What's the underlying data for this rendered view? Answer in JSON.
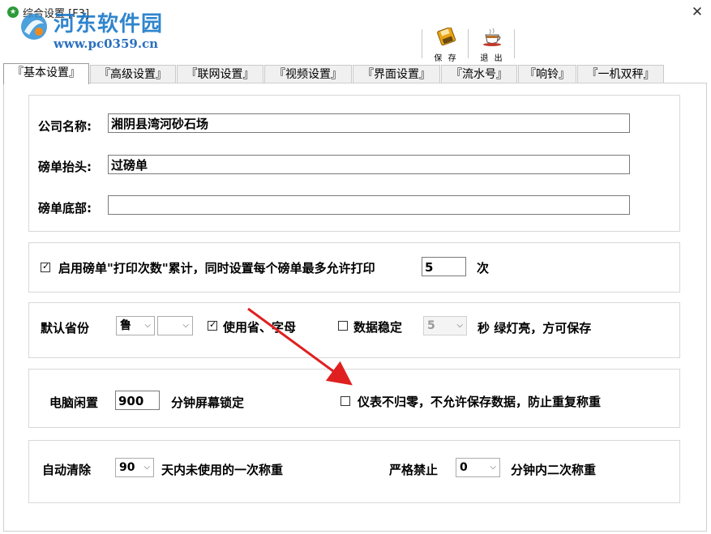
{
  "window": {
    "title": "综合设置 [F3]",
    "close_glyph": "✕"
  },
  "watermark": {
    "site_name": "河东软件园",
    "url": "www.pc0359.cn"
  },
  "toolbar": {
    "save_label": "保 存",
    "exit_label": "退 出"
  },
  "tabs": [
    {
      "label": "『基本设置』",
      "active": true
    },
    {
      "label": "『高级设置』",
      "active": false
    },
    {
      "label": "『联网设置』",
      "active": false
    },
    {
      "label": "『视频设置』",
      "active": false
    },
    {
      "label": "『界面设置』",
      "active": false
    },
    {
      "label": "『流水号』",
      "active": false
    },
    {
      "label": "『响铃』",
      "active": false
    },
    {
      "label": "『一机双秤』",
      "active": false
    }
  ],
  "company": {
    "company_name_label": "公司名称:",
    "company_name_value": "湘阴县湾河砂石场",
    "header_label": "磅单抬头:",
    "header_value": "过磅单",
    "footer_label": "磅单底部:",
    "footer_value": ""
  },
  "print_count": {
    "checked": true,
    "label": "启用磅单\"打印次数\"累计，同时设置每个磅单最多允许打印",
    "value": "5",
    "unit": "次"
  },
  "province": {
    "label": "默认省份",
    "province_value": "鲁",
    "letter_value": "",
    "use_letters_checked": true,
    "use_letters_label": "使用省、字母",
    "stable_checked": false,
    "stable_label": "数据稳定",
    "stable_seconds": "5",
    "stable_suffix": "秒  绿灯亮，方可保存"
  },
  "idle": {
    "label": "电脑闲置",
    "minutes": "900",
    "suffix": "分钟屏幕锁定",
    "no_zero_checked": false,
    "no_zero_label": "仪表不归零，不允许保存数据，防止重复称重"
  },
  "cleanup": {
    "label": "自动清除",
    "days": "90",
    "days_suffix": "天内未使用的一次称重",
    "strict_label": "严格禁止",
    "strict_minutes": "0",
    "strict_suffix": "分钟内二次称重"
  },
  "annotation": {
    "color": "#e02020"
  },
  "icons": {
    "save": "floppy-disk-icon",
    "exit": "coffee-cup-icon",
    "app": "app-icon",
    "close": "close-icon",
    "dropdown": "chevron-down-icon"
  }
}
